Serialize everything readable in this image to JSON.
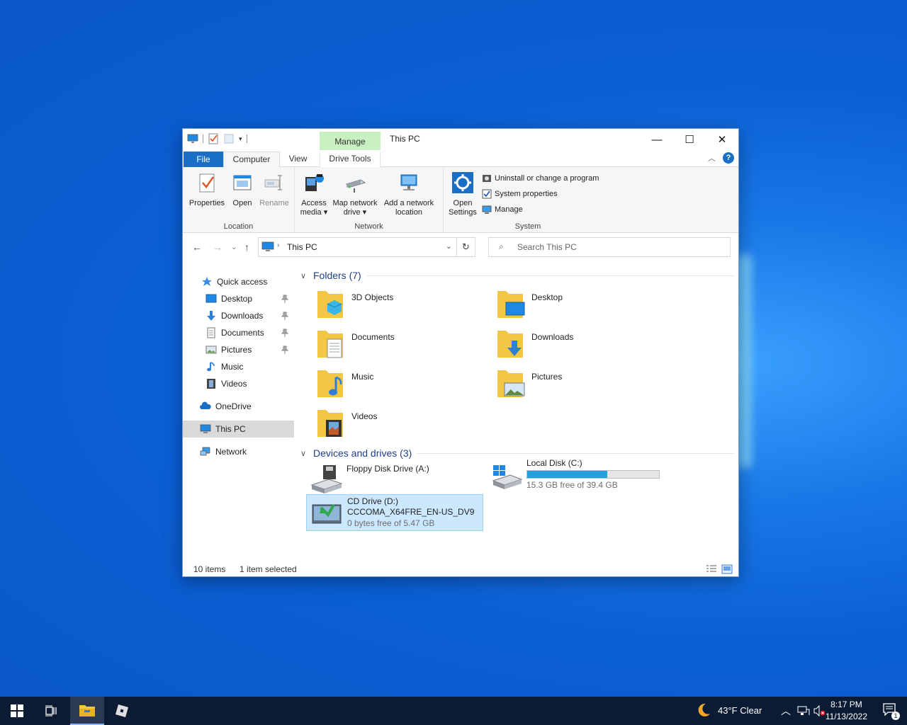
{
  "window": {
    "title": "This PC",
    "contextual_tab": "Manage",
    "controls": {
      "minimize": "—",
      "maximize": "☐",
      "close": "✕"
    }
  },
  "tabs": {
    "file": "File",
    "computer": "Computer",
    "view": "View",
    "drive_tools": "Drive Tools"
  },
  "ribbon": {
    "location": {
      "label": "Location",
      "properties": "Properties",
      "open": "Open",
      "rename": "Rename"
    },
    "network": {
      "label": "Network",
      "access_media_1": "Access",
      "access_media_2": "media ▾",
      "map_drive_1": "Map network",
      "map_drive_2": "drive ▾",
      "add_location_1": "Add a network",
      "add_location_2": "location"
    },
    "system": {
      "label": "System",
      "open_settings_1": "Open",
      "open_settings_2": "Settings",
      "uninstall": "Uninstall or change a program",
      "system_properties": "System properties",
      "manage": "Manage"
    }
  },
  "address": {
    "crumb": "This PC",
    "search_placeholder": "Search This PC"
  },
  "nav": {
    "quick_access": "Quick access",
    "desktop": "Desktop",
    "downloads": "Downloads",
    "documents": "Documents",
    "pictures": "Pictures",
    "music": "Music",
    "videos": "Videos",
    "onedrive": "OneDrive",
    "this_pc": "This PC",
    "network": "Network"
  },
  "folders": {
    "header": "Folders (7)",
    "items": [
      "3D Objects",
      "Desktop",
      "Documents",
      "Downloads",
      "Music",
      "Pictures",
      "Videos"
    ]
  },
  "drives": {
    "header": "Devices and drives (3)",
    "floppy": "Floppy Disk Drive (A:)",
    "local_c": "Local Disk (C:)",
    "local_c_free": "15.3 GB free of 39.4 GB",
    "local_c_used_fraction": 0.61,
    "cd_name": "CD Drive (D:)",
    "cd_label": "CCCOMA_X64FRE_EN-US_DV9",
    "cd_free": "0 bytes free of 5.47 GB"
  },
  "status": {
    "items": "10 items",
    "selected": "1 item selected"
  },
  "taskbar": {
    "weather": "43°F  Clear",
    "time": "8:17 PM",
    "date": "11/13/2022",
    "notifications": "1"
  },
  "colors": {
    "accent": "#1a6fc4",
    "manage_tab": "#c9f0c0",
    "selection": "#cce8ff",
    "drive_bar": "#26a0da"
  }
}
